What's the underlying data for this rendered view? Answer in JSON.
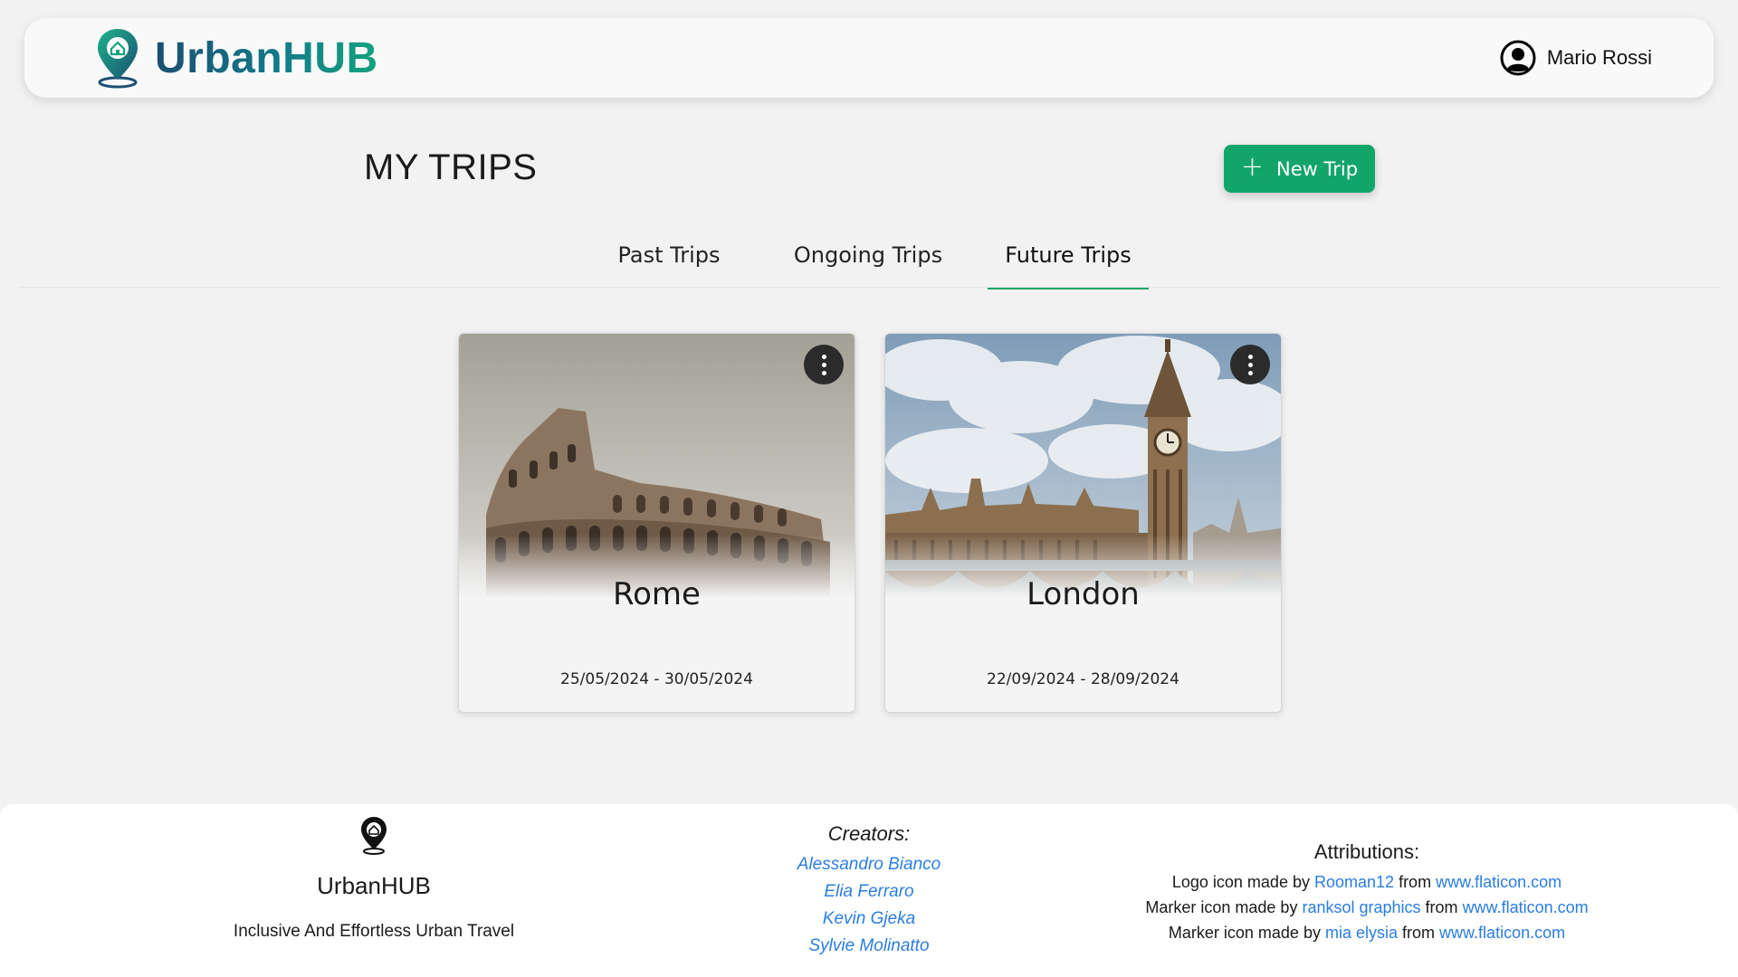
{
  "header": {
    "brand": "UrbanHUB",
    "user_name": "Mario Rossi"
  },
  "page": {
    "title": "MY TRIPS",
    "new_trip_label": "New Trip"
  },
  "tabs": [
    {
      "label": "Past Trips",
      "active": false
    },
    {
      "label": "Ongoing Trips",
      "active": false
    },
    {
      "label": "Future Trips",
      "active": true
    }
  ],
  "trips": [
    {
      "city": "Rome",
      "dates": "25/05/2024 - 30/05/2024"
    },
    {
      "city": "London",
      "dates": "22/09/2024 - 28/09/2024"
    }
  ],
  "footer": {
    "brand": "UrbanHUB",
    "tagline": "Inclusive And Effortless Urban Travel",
    "creators_title": "Creators:",
    "creators": [
      "Alessandro Bianco",
      "Elia Ferraro",
      "Kevin Gjeka",
      "Sylvie Molinatto"
    ],
    "attributions_title": "Attributions:",
    "attributions": [
      {
        "prefix": "Logo icon made by",
        "author": "Rooman12",
        "mid": "from",
        "site": "www.flaticon.com"
      },
      {
        "prefix": "Marker icon made by",
        "author": "ranksol graphics",
        "mid": "from",
        "site": "www.flaticon.com"
      },
      {
        "prefix": "Marker icon made by",
        "author": "mia elysia",
        "mid": "from",
        "site": "www.flaticon.com"
      }
    ]
  },
  "colors": {
    "accent": "#12a56a",
    "brand_start": "#1b4f72",
    "brand_end": "#14a37f",
    "link": "#2a7de1"
  }
}
